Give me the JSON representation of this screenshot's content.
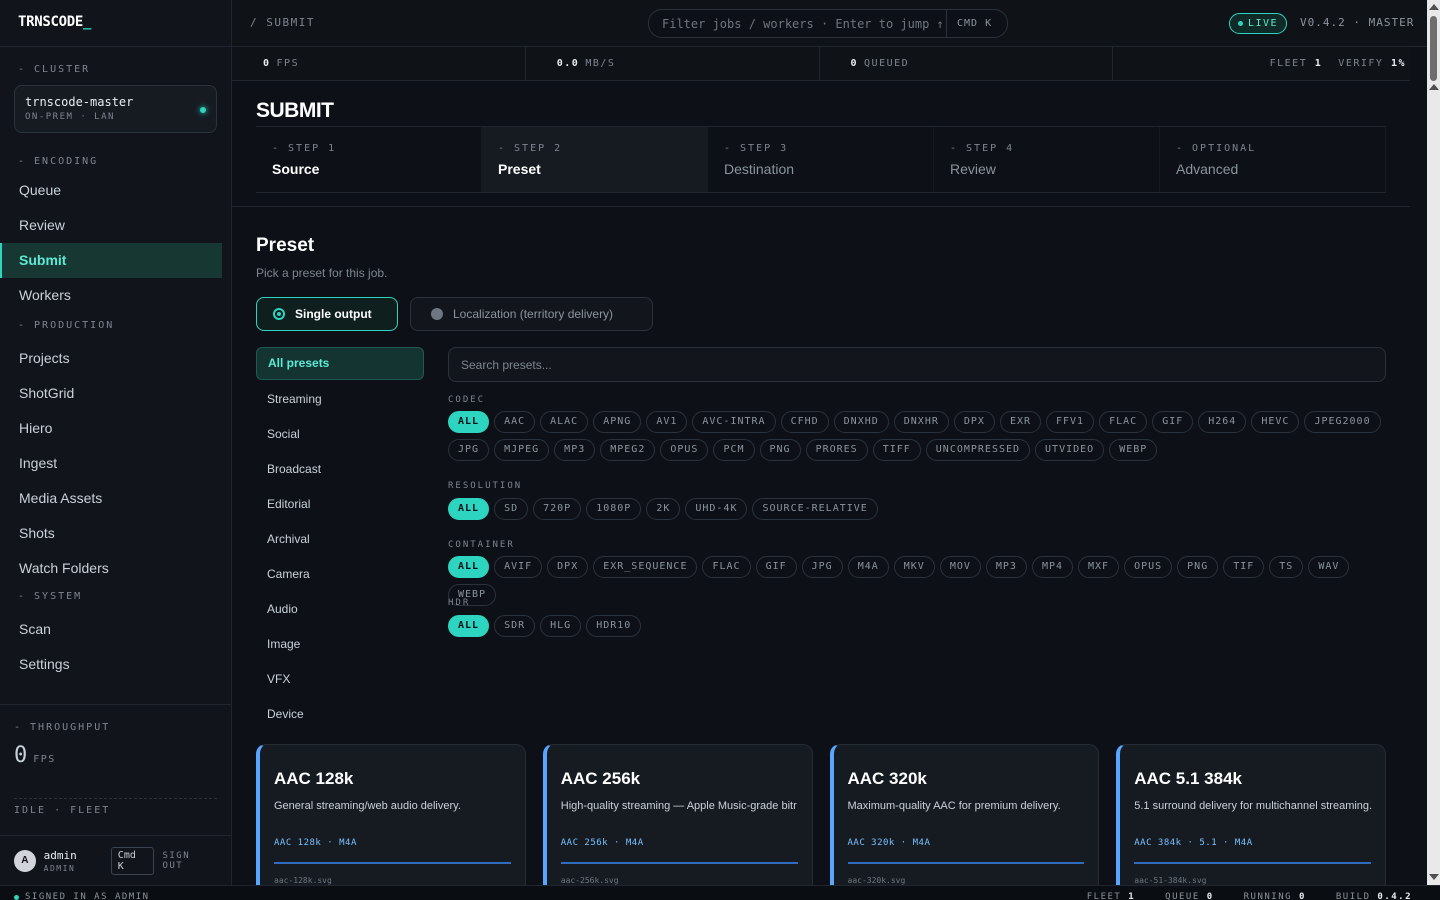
{
  "brand": {
    "name": "TRNSCODE",
    "cursor": "_"
  },
  "sidebar": {
    "cluster_label": "- CLUSTER",
    "cluster": {
      "name": "trnscode-master",
      "sub": "ON-PREM · LAN"
    },
    "encoding_label": "- ENCODING",
    "encoding_items": [
      "Queue",
      "Review",
      "Submit",
      "Workers"
    ],
    "production_label": "- PRODUCTION",
    "production_items": [
      "Projects",
      "ShotGrid",
      "Hiero",
      "Ingest",
      "Media Assets",
      "Shots",
      "Watch Folders"
    ],
    "system_label": "- SYSTEM",
    "system_items": [
      "Scan",
      "Settings"
    ],
    "throughput_label": "- THROUGHPUT",
    "throughput_value": "0",
    "throughput_unit": "FPS",
    "fleet_status": "IDLE · FLEET",
    "user": {
      "initial": "A",
      "name": "admin",
      "role": "ADMIN",
      "kbd": "Cmd K",
      "signout": "SIGN OUT"
    }
  },
  "topbar": {
    "crumb": "/  SUBMIT",
    "search_placeholder": "Filter jobs / workers · Enter to jump ↑",
    "search_kbd": "CMD K",
    "live": "LIVE",
    "version": "V0.4.2 · MASTER"
  },
  "stats": {
    "fps_value": "0",
    "fps_label": "FPS",
    "mbs_value": "0.0",
    "mbs_label": "MB/S",
    "queued_value": "0",
    "queued_label": "QUEUED",
    "fleet_label": "FLEET",
    "fleet_value": "1",
    "verify_label": "VERIFY",
    "verify_value": "1%"
  },
  "main": {
    "title": "SUBMIT",
    "steps": [
      {
        "num": "- STEP 1",
        "title": "Source"
      },
      {
        "num": "- STEP 2",
        "title": "Preset"
      },
      {
        "num": "- STEP 3",
        "title": "Destination"
      },
      {
        "num": "- STEP 4",
        "title": "Review"
      },
      {
        "num": "- OPTIONAL",
        "title": "Advanced"
      }
    ],
    "section_title": "Preset",
    "section_sub": "Pick a preset for this job.",
    "mode_single": "Single output",
    "mode_local": "Localization (territory delivery)",
    "categories": [
      "All presets",
      "Streaming",
      "Social",
      "Broadcast",
      "Editorial",
      "Archival",
      "Camera",
      "Audio",
      "Image",
      "VFX",
      "Device"
    ],
    "search_placeholder": "Search presets...",
    "filters": {
      "codec_label": "CODEC",
      "codec": [
        "ALL",
        "AAC",
        "ALAC",
        "APNG",
        "AV1",
        "AVC-INTRA",
        "CFHD",
        "DNXHD",
        "DNXHR",
        "DPX",
        "EXR",
        "FFV1",
        "FLAC",
        "GIF",
        "H264",
        "HEVC",
        "JPEG2000",
        "JPG",
        "MJPEG",
        "MP3",
        "MPEG2",
        "OPUS",
        "PCM",
        "PNG",
        "PRORES",
        "TIFF",
        "UNCOMPRESSED",
        "UTVIDEO",
        "WEBP"
      ],
      "resolution_label": "RESOLUTION",
      "resolution": [
        "ALL",
        "SD",
        "720P",
        "1080P",
        "2K",
        "UHD-4K",
        "SOURCE-RELATIVE"
      ],
      "container_label": "CONTAINER",
      "container": [
        "ALL",
        "AVIF",
        "DPX",
        "EXR_SEQUENCE",
        "FLAC",
        "GIF",
        "JPG",
        "M4A",
        "MKV",
        "MOV",
        "MP3",
        "MP4",
        "MXF",
        "OPUS",
        "PNG",
        "TIF",
        "TS",
        "WAV",
        "WEBP"
      ],
      "hdr_label": "HDR",
      "hdr": [
        "ALL",
        "SDR",
        "HLG",
        "HDR10"
      ]
    },
    "cards": [
      {
        "title": "AAC 128k",
        "desc": "General streaming/web audio delivery.",
        "tag": "AAC 128k · M4A",
        "file": "aac-128k.svg"
      },
      {
        "title": "AAC 256k",
        "desc": "High-quality streaming — Apple Music-grade bitr",
        "tag": "AAC 256k · M4A",
        "file": "aac-256k.svg"
      },
      {
        "title": "AAC 320k",
        "desc": "Maximum-quality AAC for premium delivery.",
        "tag": "AAC 320k · M4A",
        "file": "aac-320k.svg"
      },
      {
        "title": "AAC 5.1 384k",
        "desc": "5.1 surround delivery for multichannel streaming.",
        "tag": "AAC 384k · 5.1 · M4A",
        "file": "aac-51-384k.svg"
      }
    ]
  },
  "footer": {
    "signed_in": "SIGNED IN AS ADMIN",
    "fleet_label": "FLEET",
    "fleet_value": "1",
    "queue_label": "QUEUE",
    "queue_value": "0",
    "running_label": "RUNNING",
    "running_value": "0",
    "build_label": "BUILD",
    "build_value": "0.4.2"
  },
  "colors": {
    "accent": "#2dd4bf",
    "card_accent": "#58a6ff",
    "bg": "#0d1117"
  }
}
